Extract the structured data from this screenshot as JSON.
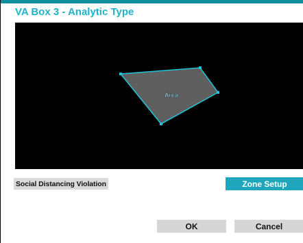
{
  "dialog": {
    "title": "VA Box 3 - Analytic Type"
  },
  "canvas": {
    "zone_label": "Area",
    "colors": {
      "background": "#000000",
      "fill": "#5f5f5f",
      "outline": "#22c4dc",
      "label_text": "#bdf3ff"
    }
  },
  "controls": {
    "analytic_type_value": "Social Distancing Violation",
    "zone_setup_label": "Zone Setup",
    "ok_label": "OK",
    "cancel_label": "Cancel"
  },
  "colors": {
    "accent": "#1fa6bd",
    "title_text": "#1fb2c9",
    "button_bg": "#d6d6d6"
  }
}
